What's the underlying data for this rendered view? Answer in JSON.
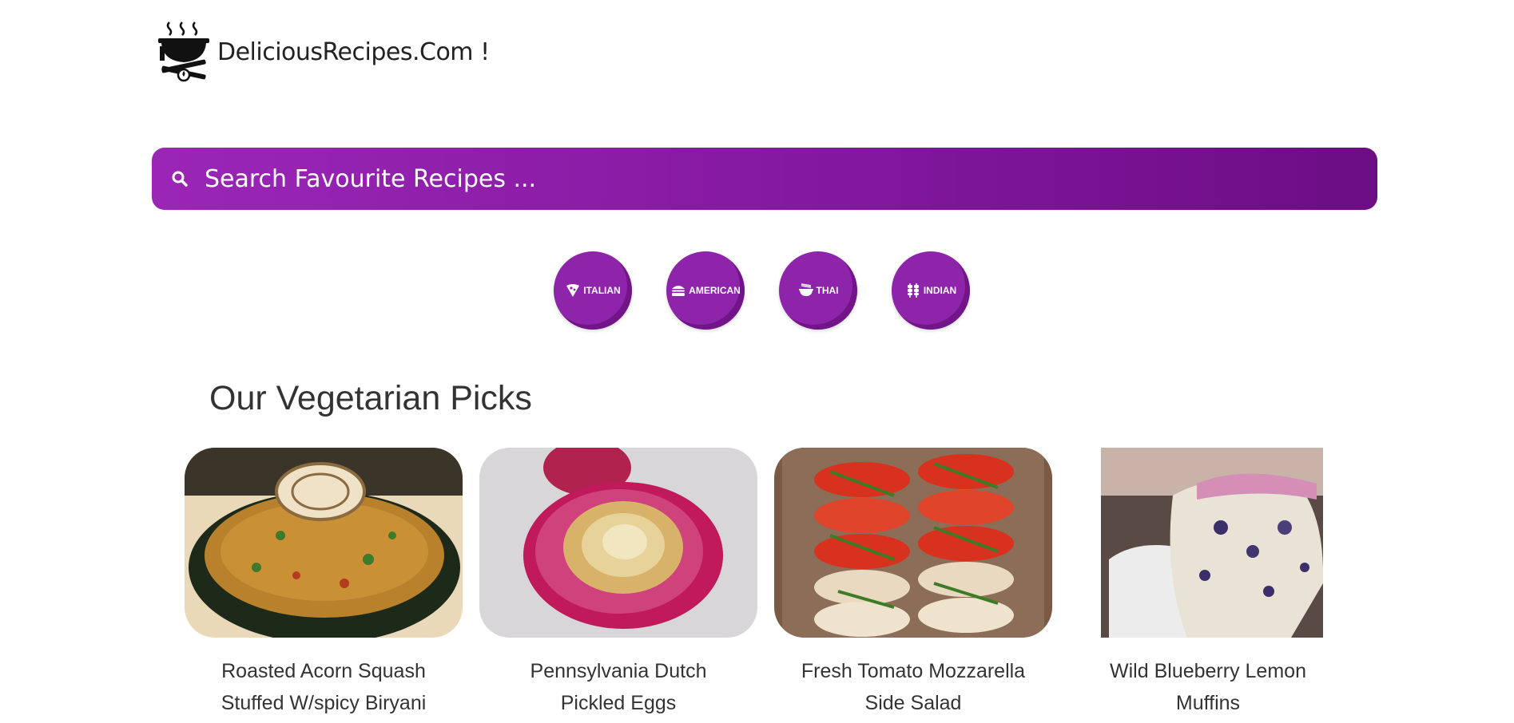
{
  "brand": {
    "name": "DeliciousRecipes.Com !",
    "logo_icon": "cooking-pot-fire-icon"
  },
  "search": {
    "placeholder": "Search Favourite Recipes ...",
    "value": "",
    "icon": "search-icon"
  },
  "categories": [
    {
      "label": "ITALIAN",
      "icon": "pizza-slice-icon"
    },
    {
      "label": "AMERICAN",
      "icon": "burger-icon"
    },
    {
      "label": "THAI",
      "icon": "noodle-bowl-icon"
    },
    {
      "label": "INDIAN",
      "icon": "kebab-skewer-icon"
    }
  ],
  "section": {
    "title": "Our Vegetarian Picks"
  },
  "recipes": [
    {
      "title": "Roasted Acorn Squash Stuffed W/spicy Biryani",
      "image": "stuffed-acorn-squash-photo"
    },
    {
      "title": "Pennsylvania Dutch Pickled Eggs",
      "image": "pickled-egg-photo"
    },
    {
      "title": "Fresh Tomato Mozzarella Side Salad",
      "image": "tomato-mozzarella-salad-photo"
    },
    {
      "title": "Wild Blueberry Lemon Muffins",
      "image": "blueberry-muffin-photo"
    }
  ],
  "colors": {
    "accent": "#8e24aa",
    "accent_dark": "#6c0d84",
    "text": "#333333"
  }
}
